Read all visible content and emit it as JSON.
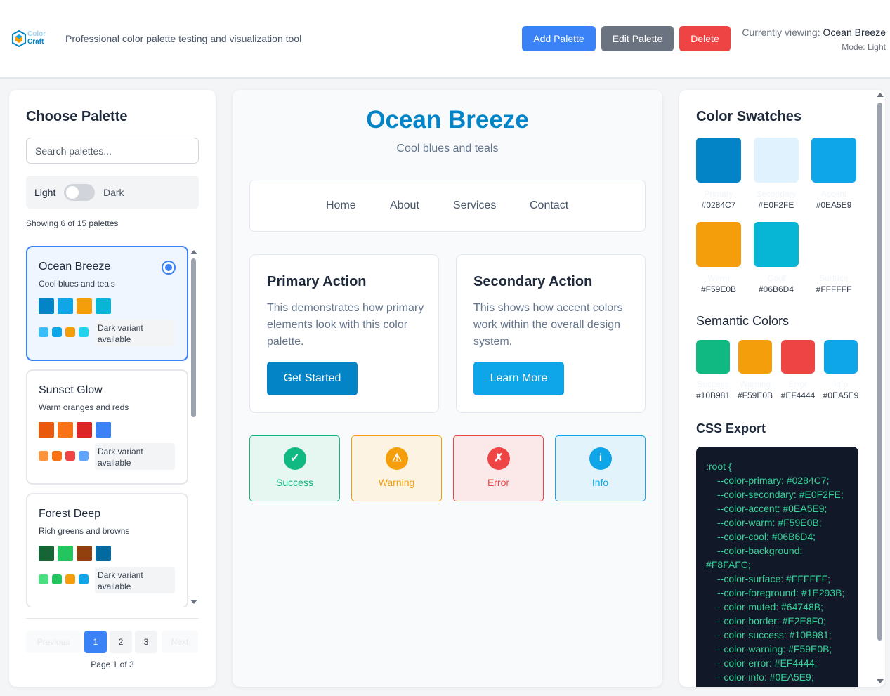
{
  "header": {
    "logo": {
      "line1": "Color",
      "line2": "Craft"
    },
    "tagline": "Professional color palette testing and visualization tool",
    "add_label": "Add Palette",
    "edit_label": "Edit Palette",
    "delete_label": "Delete",
    "viewing_prefix": "Currently viewing: ",
    "viewing_name": "Ocean Breeze",
    "mode_text": "Mode: Light"
  },
  "sidebar": {
    "title": "Choose Palette",
    "search_placeholder": "Search palettes...",
    "toggle": {
      "light": "Light",
      "dark": "Dark"
    },
    "showing": "Showing 6 of 15 palettes",
    "palettes": [
      {
        "name": "Ocean Breeze",
        "desc": "Cool blues and teals",
        "selected": true,
        "colors": [
          "#0284c7",
          "#0ea5e9",
          "#f59e0b",
          "#06b6d4"
        ],
        "dark_colors": [
          "#38bdf8",
          "#0ea5e9",
          "#f59e0b",
          "#22d3ee"
        ],
        "dark_text": "Dark variant available"
      },
      {
        "name": "Sunset Glow",
        "desc": "Warm oranges and reds",
        "selected": false,
        "colors": [
          "#ea580c",
          "#f97316",
          "#dc2626",
          "#3b82f6"
        ],
        "dark_colors": [
          "#fb923c",
          "#f97316",
          "#ef4444",
          "#60a5fa"
        ],
        "dark_text": "Dark variant available"
      },
      {
        "name": "Forest Deep",
        "desc": "Rich greens and browns",
        "selected": false,
        "colors": [
          "#166534",
          "#22c55e",
          "#92400e",
          "#0369a1"
        ],
        "dark_colors": [
          "#4ade80",
          "#22c55e",
          "#f59e0b",
          "#0ea5e9"
        ],
        "dark_text": "Dark variant available"
      }
    ],
    "pagination": {
      "prev": "Previous",
      "pages": [
        "1",
        "2",
        "3"
      ],
      "next": "Next",
      "page_of": "Page 1 of 3"
    }
  },
  "preview": {
    "title": "Ocean Breeze",
    "subtitle": "Cool blues and teals",
    "nav": [
      "Home",
      "About",
      "Services",
      "Contact"
    ],
    "primary": {
      "heading": "Primary Action",
      "text": "This demonstrates how primary elements look with this color palette.",
      "button": "Get Started"
    },
    "secondary": {
      "heading": "Secondary Action",
      "text": "This shows how accent colors work within the overall design system.",
      "button": "Learn More"
    },
    "status": [
      {
        "label": "Success",
        "icon": "✓"
      },
      {
        "label": "Warning",
        "icon": "⚠"
      },
      {
        "label": "Error",
        "icon": "✗"
      },
      {
        "label": "Info",
        "icon": "i"
      }
    ]
  },
  "swatches": {
    "title": "Color Swatches",
    "items": [
      {
        "name": "Primary",
        "hex": "#0284C7",
        "color": "#0284c7"
      },
      {
        "name": "Secondary",
        "hex": "#E0F2FE",
        "color": "#e0f2fe"
      },
      {
        "name": "Accent",
        "hex": "#0EA5E9",
        "color": "#0ea5e9"
      },
      {
        "name": "Warm",
        "hex": "#F59E0B",
        "color": "#f59e0b"
      },
      {
        "name": "Cool",
        "hex": "#06B6D4",
        "color": "#06b6d4"
      },
      {
        "name": "Surface",
        "hex": "#FFFFFF",
        "color": "#ffffff"
      }
    ],
    "semantic_title": "Semantic Colors",
    "semantic": [
      {
        "name": "Success",
        "hex": "#10B981",
        "color": "#10b981"
      },
      {
        "name": "Warning",
        "hex": "#F59E0B",
        "color": "#f59e0b"
      },
      {
        "name": "Error",
        "hex": "#EF4444",
        "color": "#ef4444"
      },
      {
        "name": "Info",
        "hex": "#0EA5E9",
        "color": "#0ea5e9"
      }
    ],
    "css_title": "CSS Export",
    "css_lines": [
      ":root {",
      "--color-primary: #0284C7;",
      "--color-secondary: #E0F2FE;",
      "--color-accent: #0EA5E9;",
      "--color-warm: #F59E0B;",
      "--color-cool: #06B6D4;",
      "--color-background:",
      "#F8FAFC;",
      "--color-surface: #FFFFFF;",
      "--color-foreground: #1E293B;",
      "--color-muted: #64748B;",
      "--color-border: #E2E8F0;",
      "--color-success: #10B981;",
      "--color-warning: #F59E0B;",
      "--color-error: #EF4444;",
      "--color-info: #0EA5E9;",
      "}"
    ]
  }
}
